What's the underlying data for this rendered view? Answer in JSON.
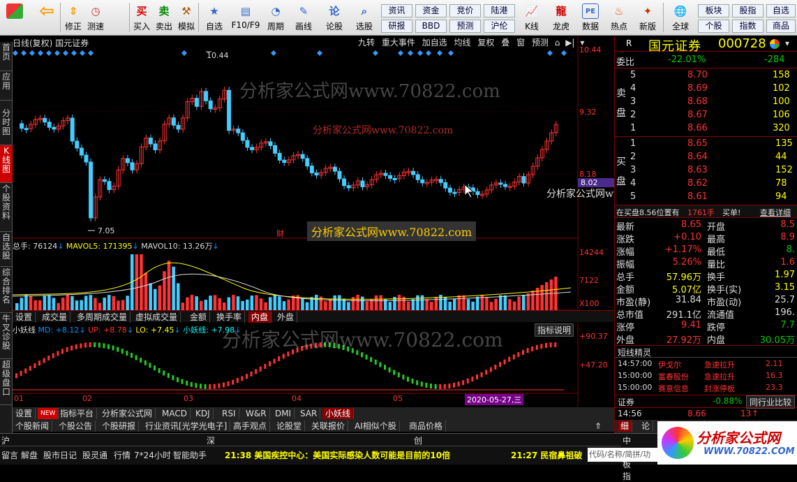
{
  "toolbar": {
    "buttons": [
      {
        "label": "",
        "icon": "windows-grid-icon"
      },
      {
        "label": "",
        "icon": "back-arrow-icon"
      },
      {
        "label": "修正",
        "icon": "arrow-up-down-icon"
      },
      {
        "label": "测速",
        "icon": "clock-icon"
      },
      {
        "label": "买入",
        "icon": "buy-icon"
      },
      {
        "label": "卖出",
        "icon": "sell-icon"
      },
      {
        "label": "模拟",
        "icon": "hammer-icon"
      },
      {
        "label": "自选",
        "icon": "star-folder-icon"
      },
      {
        "label": "F10/F9",
        "icon": "f10-icon"
      },
      {
        "label": "周期",
        "icon": "period-icon"
      },
      {
        "label": "画线",
        "icon": "pencil-icon"
      },
      {
        "label": "论股",
        "icon": "chat-icon"
      },
      {
        "label": "选股",
        "icon": "magnifier-icon"
      },
      {
        "label": "K线",
        "icon": "kline-icon"
      },
      {
        "label": "龙虎",
        "icon": "dragon-tiger-icon"
      },
      {
        "label": "数据",
        "icon": "data-pe-icon"
      },
      {
        "label": "热点",
        "icon": "fire-icon"
      },
      {
        "label": "新版",
        "icon": "new-version-icon"
      },
      {
        "label": "全球",
        "icon": "globe-icon"
      }
    ],
    "small": [
      [
        "资讯",
        "资金",
        "竞价",
        "陆港"
      ],
      [
        "研报",
        "BBD",
        "预测",
        "沪伦"
      ]
    ],
    "right": [
      [
        "板块",
        "股指",
        "自选"
      ],
      [
        "个股",
        "指数",
        "商品"
      ]
    ]
  },
  "left_tabs": [
    "首页",
    "应用",
    "分时图",
    "K线图",
    "个股资料",
    "自选股",
    "综合排名",
    "牛叉诊股",
    "超级盘口"
  ],
  "chart": {
    "title": "日线(复权)",
    "broker": "国元证券",
    "top_buttons": [
      "九转",
      "重大事件",
      "加自选",
      "均线",
      "复权",
      "叠",
      "窗",
      "预测"
    ],
    "price_labels": [
      "10.44",
      "9.32",
      "8.18",
      "8.02"
    ],
    "high_label": "10.44",
    "low_label": "7.05",
    "cai": "财",
    "vol_info": {
      "total": "总手: 76124",
      "ma5": "MAVOL5: 171395",
      "ma10": "MAVOL10: 13.26万"
    },
    "vol_labels": [
      "14244",
      "7122",
      "X100"
    ],
    "sub_tabs": [
      "设置",
      "成交量",
      "多周期成交量",
      "虚拟成交量",
      "金额",
      "换手率",
      "内盘",
      "外盘"
    ],
    "ind_info": {
      "name": "小妖线",
      "md": "MD: +8.12",
      "up": "UP: +8.78",
      "lo": "LO: +7.45",
      "xyx": "小妖线: +7.98"
    },
    "ind_btn": "指标说明",
    "ind_labels": [
      "+90.37",
      "+47.20"
    ],
    "months": [
      "01",
      "02",
      "03",
      "04",
      "05"
    ],
    "date_tag": "2020-05-27,三",
    "bottom_tabs": [
      "设置",
      "NEW",
      "指标平台",
      "分析家公式网",
      "MACD",
      "KDJ",
      "RSI",
      "W&R",
      "DMI",
      "SAR",
      "小妖线"
    ],
    "news_tabs": [
      "个股新闻",
      "个股公告",
      "个股研报",
      "行业资讯[光学光电子]",
      "高手观点",
      "论股堂",
      "关联报价",
      "AI相似个股",
      "商品价格"
    ],
    "watermark": "分析家公式网www.70822.com"
  },
  "quote": {
    "name": "国元证券",
    "code": "000728",
    "r": "R",
    "weibi": {
      "label": "委比",
      "pct": "-22.01%",
      "val": "-284"
    },
    "sell": [
      [
        "5",
        "8.70",
        "158"
      ],
      [
        "4",
        "8.69",
        "102"
      ],
      [
        "3",
        "8.68",
        "100"
      ],
      [
        "2",
        "8.67",
        "106"
      ],
      [
        "1",
        "8.66",
        "320"
      ]
    ],
    "buy": [
      [
        "1",
        "8.65",
        "135"
      ],
      [
        "2",
        "8.64",
        "44"
      ],
      [
        "3",
        "8.63",
        "152"
      ],
      [
        "4",
        "8.62",
        "78"
      ],
      [
        "5",
        "8.61",
        "94"
      ]
    ],
    "sell_label": "卖盘",
    "buy_label": "买盘",
    "notice": {
      "text": "在买盘8.56位置有",
      "hand": "1761手",
      "act": "买单!",
      "link": "查看详细"
    },
    "stats": [
      [
        "最新",
        "8.65",
        "开盘",
        "8.5"
      ],
      [
        "涨跌",
        "+0.10",
        "最高",
        "8.9"
      ],
      [
        "涨幅",
        "+1.17%",
        "最低",
        "8."
      ],
      [
        "振幅",
        "5.26%",
        "量比",
        "1.6"
      ],
      [
        "总手",
        "57.96万",
        "换手",
        "1.97"
      ],
      [
        "金额",
        "5.07亿",
        "换手(实)",
        "3.15"
      ],
      [
        "市盈(静)",
        "31.84",
        "市盈(动)",
        "25.7"
      ],
      [
        "总市值",
        "291.1亿",
        "流通值",
        "196."
      ],
      [
        "涨停",
        "9.41",
        "跌停",
        "7.7"
      ],
      [
        "外盘",
        "27.92万",
        "内盘",
        "30.05万"
      ]
    ],
    "elf_title": "短线精灵",
    "elf": [
      [
        "14:57:00",
        "伊戈尔",
        "急速拉升",
        "2.11"
      ],
      [
        "15:00:00",
        "富春股份",
        "急速拉升",
        "16.3"
      ],
      [
        "15:00:00",
        "赛意信息",
        "封涨停板",
        "23.3"
      ]
    ],
    "sector": {
      "name": "证券",
      "pct": "-0.88%",
      "btn": "同行业比较"
    },
    "tick": {
      "time": "14:56",
      "price": "8.66",
      "vol": "13"
    },
    "bottom_tabs": [
      "细",
      "论",
      "势",
      "指",
      "联"
    ]
  },
  "status": {
    "items": [
      "沪",
      "深",
      "创"
    ],
    "left_items": [
      "留言",
      "解盘",
      "股市日记",
      "股灵通",
      "行情",
      "7*24小时",
      "智能助手"
    ],
    "news1": "21:38 美国疾控中心：美国实际感染人数可能是目前的10倍",
    "news2": "21:27 民宿鼻祖破",
    "search": "代码/名称/简拼/功",
    "right": "中小板指"
  },
  "logo": {
    "text": "分析家公式网",
    "url": "WWW.70822.COM"
  }
}
